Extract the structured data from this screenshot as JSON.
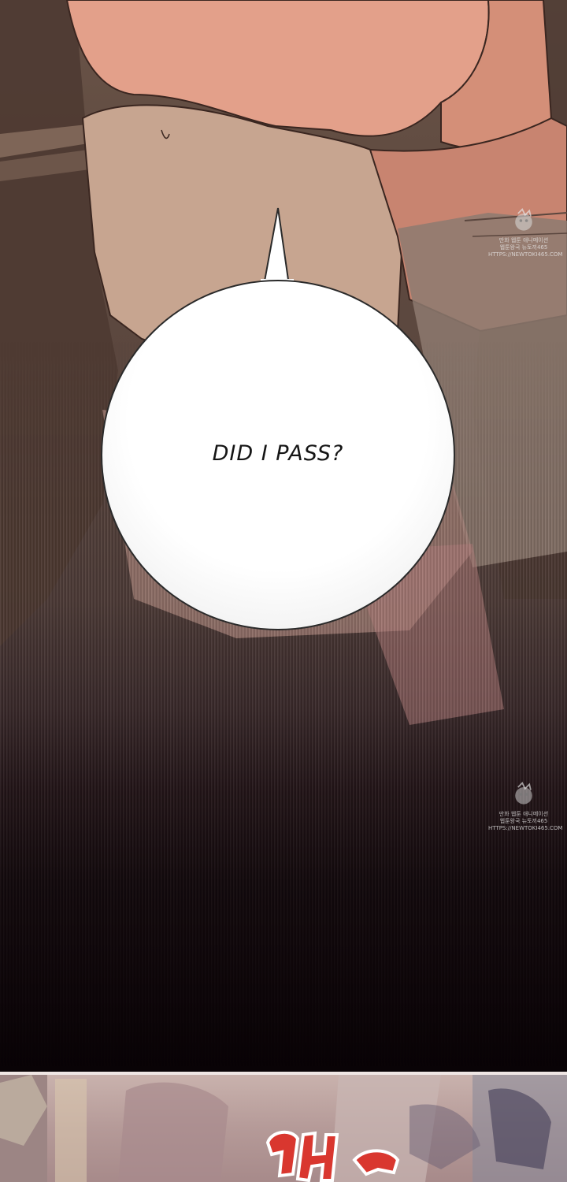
{
  "dialogue": {
    "speech_bubble_text": "DID I PASS?"
  },
  "watermarks": [
    {
      "lines": [
        "만화 웹툰 애니메이션",
        "웹툰왕국 뉴토끼465",
        "HTTPS://NEWTOKI465.COM"
      ]
    },
    {
      "lines": [
        "만화 웹툰 애니메이션",
        "웹툰왕국 뉴토끼465",
        "HTTPS://NEWTOKI465.COM"
      ]
    }
  ],
  "sound_effect": {
    "lettering": "배두"
  },
  "colors": {
    "skin_light": "#e2a48c",
    "skin_shadow": "#c9876f",
    "cloth_tan": "#b39180",
    "background_brown": "#5f4a40",
    "fade_dark": "#0c0507",
    "bubble_fill": "#ffffff",
    "bubble_outline": "#2a2a2a",
    "sfx_red": "#d9372f",
    "panel_divider": "#efe6e4"
  }
}
